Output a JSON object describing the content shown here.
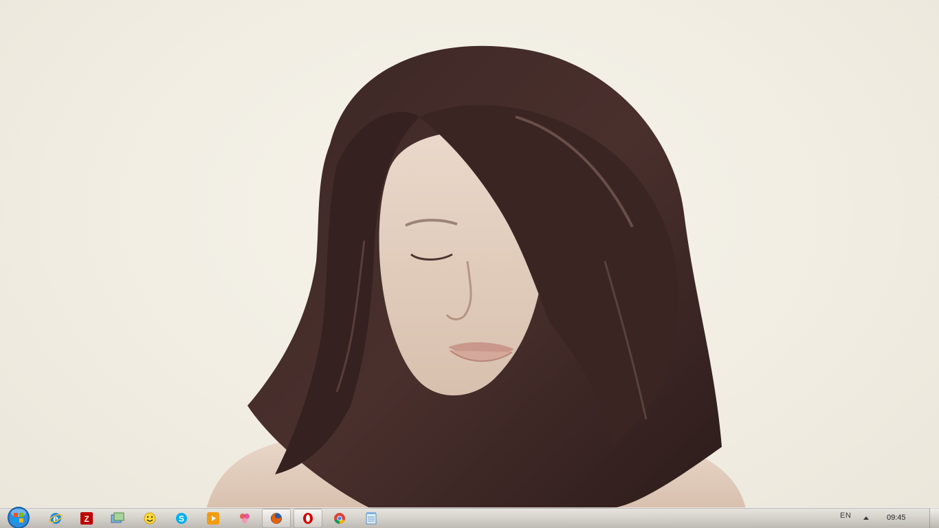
{
  "desktop": {
    "wallpaper": "portrait-woman-long-brown-hair"
  },
  "taskbar": {
    "start_icon": "windows-start-orb",
    "pinned": [
      {
        "name": "internet-explorer-icon"
      },
      {
        "name": "filezilla-icon"
      },
      {
        "name": "windows-explorer-icon"
      },
      {
        "name": "smiley-messenger-icon"
      },
      {
        "name": "skype-icon"
      },
      {
        "name": "media-player-icon"
      },
      {
        "name": "paint-splash-icon"
      },
      {
        "name": "firefox-icon",
        "active": true
      },
      {
        "name": "opera-icon",
        "active": true
      },
      {
        "name": "chrome-icon"
      },
      {
        "name": "notepad-icon"
      }
    ],
    "tray": {
      "language": "EN",
      "clock": "09:45"
    }
  },
  "colors": {
    "background": "#f2eee4",
    "taskbar": "#c8c4bf",
    "accent_start": "#1e7fd0"
  }
}
